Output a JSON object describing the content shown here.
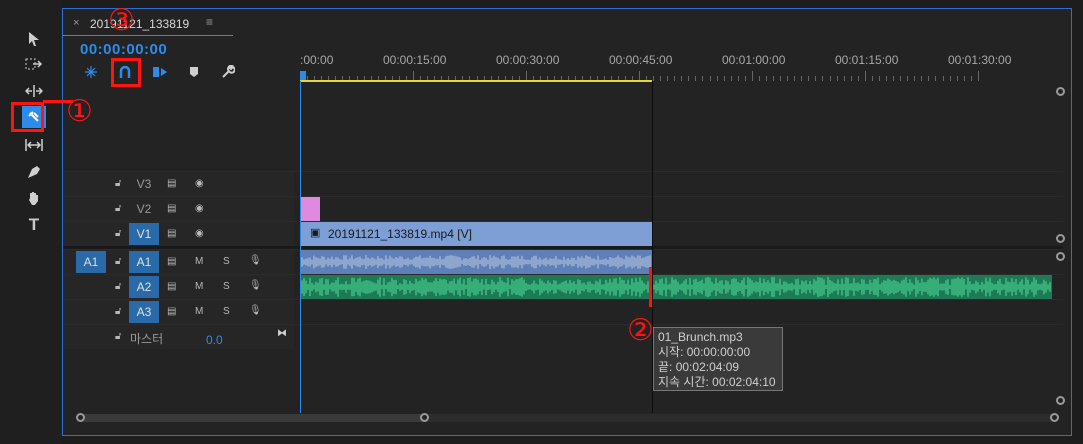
{
  "tab": {
    "close": "×",
    "title": "20191121_133819",
    "menu": "≡"
  },
  "timecode": "00:00:00:00",
  "ruler": {
    "labels": [
      ":00:00",
      "00:00:15:00",
      "00:00:30:00",
      "00:00:45:00",
      "00:01:00:00",
      "00:01:15:00",
      "00:01:30:00"
    ]
  },
  "tools": [
    {
      "name": "selection-tool-icon",
      "glyph": "▶"
    },
    {
      "name": "track-select-tool-icon",
      "glyph": "⇥"
    },
    {
      "name": "ripple-edit-tool-icon",
      "glyph": "⇹"
    },
    {
      "name": "razor-tool-icon",
      "glyph": "◆"
    },
    {
      "name": "slip-tool-icon",
      "glyph": "↔"
    },
    {
      "name": "pen-tool-icon",
      "glyph": "✎"
    },
    {
      "name": "hand-tool-icon",
      "glyph": "✋"
    },
    {
      "name": "type-tool-icon",
      "glyph": "T"
    }
  ],
  "tracks": {
    "video": [
      {
        "name": "V3",
        "on": false
      },
      {
        "name": "V2",
        "on": false
      },
      {
        "name": "V1",
        "on": true
      }
    ],
    "audio": [
      {
        "name": "A1",
        "on": true,
        "source": "A1"
      },
      {
        "name": "A2",
        "on": true,
        "source": ""
      },
      {
        "name": "A3",
        "on": true,
        "source": ""
      }
    ],
    "master": {
      "label": "마스터",
      "value": "0.0"
    },
    "mute": "M",
    "solo": "S"
  },
  "clips": {
    "v1_label": "20191121_133819.mp4 [V]"
  },
  "tooltip": {
    "line1": "01_Brunch.mp3",
    "line2": "시작: 00:00:00:00",
    "line3": "끝: 00:02:04:09",
    "line4": "지속 시간: 00:02:04:10"
  },
  "annotations": {
    "one": "①",
    "two": "②",
    "three": "③"
  },
  "colors": {
    "accent": "#2d8ceb",
    "track_on": "#2b6aa8",
    "video_clip": "#7d9fd6",
    "audio_clip": "#21a36a",
    "marker_red": "#ff1414",
    "v2_clip": "#e089e0"
  }
}
